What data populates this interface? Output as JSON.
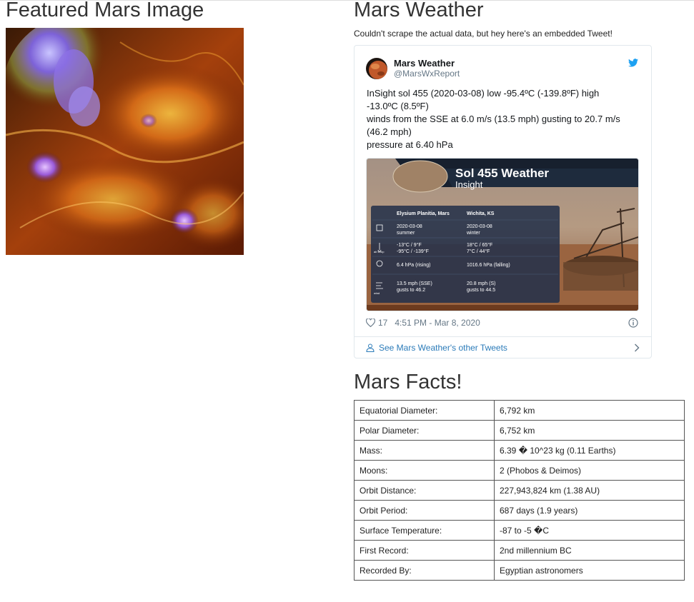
{
  "featured": {
    "title": "Featured Mars Image"
  },
  "weather": {
    "title": "Mars Weather",
    "note": "Couldn't scrape the actual data, but hey here's an embedded Tweet!",
    "tweet": {
      "name": "Mars Weather",
      "handle": "@MarsWxReport",
      "lines": [
        "InSight sol 455 (2020-03-08) low -95.4ºC (-139.8ºF) high",
        "-13.0ºC (8.5ºF)",
        "winds from the SSE at 6.0 m/s (13.5 mph) gusting to 20.7 m/s",
        "(46.2 mph)",
        "pressure at 6.40 hPa"
      ],
      "likes": "17",
      "timestamp": "4:51 PM - Mar 8, 2020",
      "footer_link": "See Mars Weather's other Tweets",
      "media": {
        "title": "Sol 455 Weather",
        "subtitle": "Insight",
        "col1_header": "Elysium Planitia, Mars",
        "col2_header": "Wichita, KS",
        "rows": [
          {
            "label": "",
            "c1": [
              "2020-03-08",
              "summer"
            ],
            "c2": [
              "2020-03-08",
              "winter"
            ]
          },
          {
            "label": "air temp",
            "c1": [
              "-13°C / 9°F",
              "-95°C / -139°F"
            ],
            "c2": [
              "18°C / 65°F",
              "7°C / 44°F"
            ]
          },
          {
            "label": "",
            "c1": [
              "6.4 hPa (rising)"
            ],
            "c2": [
              "1016.6 hPa (falling)"
            ]
          },
          {
            "label": "wind",
            "c1": [
              "13.5 mph (SSE)",
              "gusts to 46.2"
            ],
            "c2": [
              "20.8 mph (S)",
              "gusts to 44.5"
            ]
          }
        ]
      }
    }
  },
  "facts": {
    "title": "Mars Facts!",
    "rows": [
      [
        "Equatorial Diameter:",
        "6,792 km"
      ],
      [
        "Polar Diameter:",
        "6,752 km"
      ],
      [
        "Mass:",
        "6.39 � 10^23 kg (0.11 Earths)"
      ],
      [
        "Moons:",
        "2 (Phobos & Deimos)"
      ],
      [
        "Orbit Distance:",
        "227,943,824 km (1.38 AU)"
      ],
      [
        "Orbit Period:",
        "687 days (1.9 years)"
      ],
      [
        "Surface Temperature:",
        "-87 to -5 �C"
      ],
      [
        "First Record:",
        "2nd millennium BC"
      ],
      [
        "Recorded By:",
        "Egyptian astronomers"
      ]
    ]
  },
  "colors": {
    "heading": "#333333",
    "link": "#2b7bb9",
    "twitter_blue": "#1da1f2",
    "muted": "#657786"
  }
}
